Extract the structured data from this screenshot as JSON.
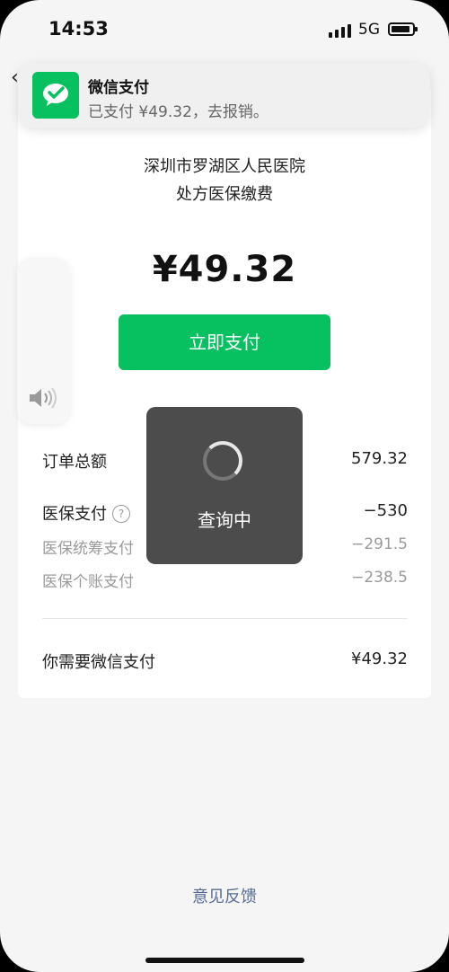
{
  "status_bar": {
    "time": "14:53",
    "network": "5G"
  },
  "notification": {
    "app_name": "微信支付",
    "message": "已支付 ¥49.32，去报销。"
  },
  "payment": {
    "payee_line1": "深圳市罗湖区人民医院",
    "payee_line2": "处方医保缴费",
    "amount": "¥49.32",
    "pay_button_label": "立即支付"
  },
  "details": {
    "order_total_label": "订单总额",
    "order_total_value": "579.32",
    "insurance_label": "医保支付",
    "insurance_value": "−530",
    "pooled_label": "医保统筹支付",
    "pooled_value": "−291.5",
    "personal_label": "医保个账支付",
    "personal_value": "−238.5",
    "need_pay_label": "你需要微信支付",
    "need_pay_value": "¥49.32"
  },
  "loading": {
    "text": "查询中"
  },
  "footer": {
    "feedback_link": "意见反馈"
  },
  "icons": {
    "help": "question-circle-icon",
    "volume": "speaker-icon",
    "app": "wechat-pay-icon",
    "back": "chevron-left-icon"
  },
  "colors": {
    "accent": "#07c160",
    "link": "#576b95"
  }
}
